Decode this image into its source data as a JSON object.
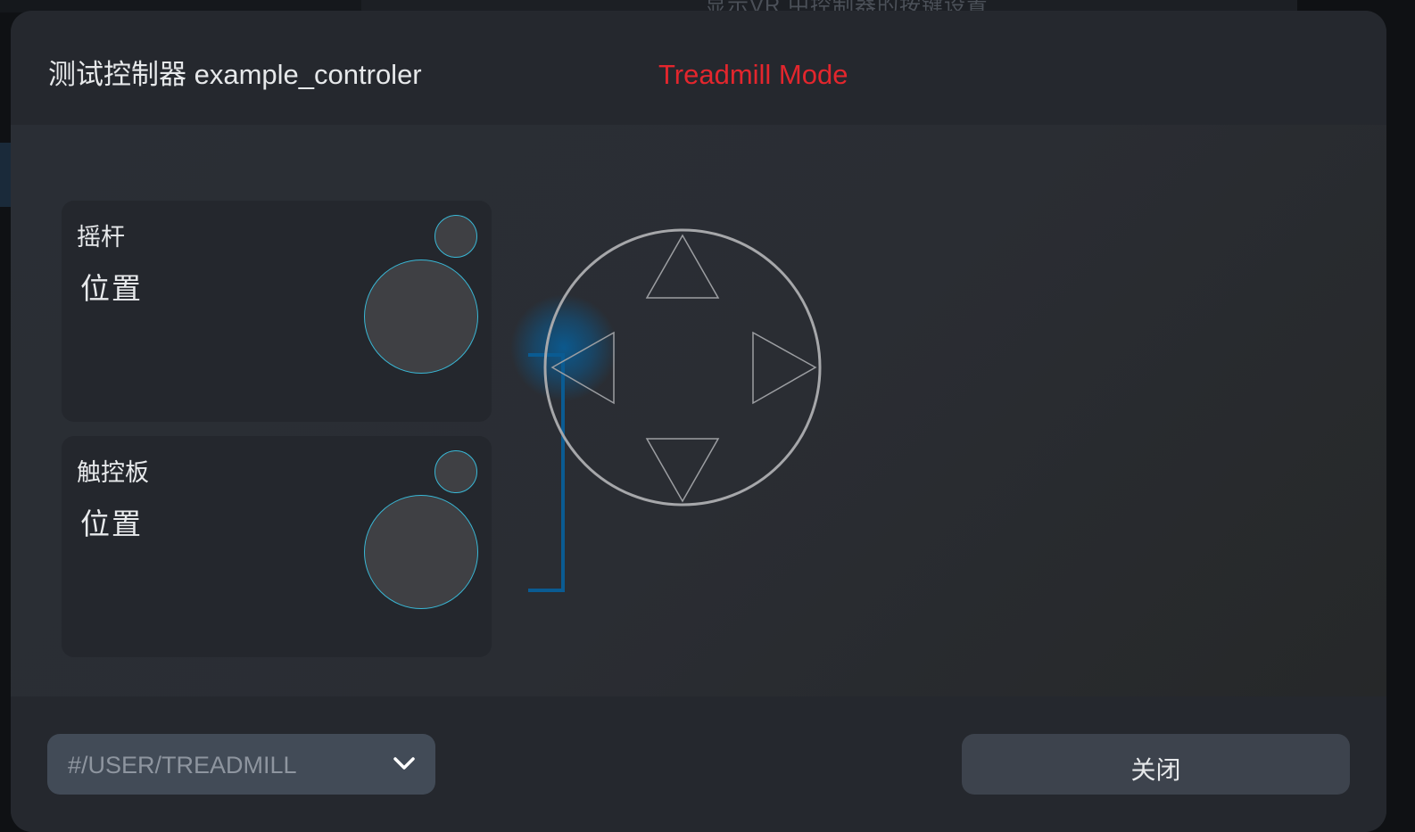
{
  "background": {
    "title_fragment": "显示VR 中控制器的按键设置"
  },
  "dialog": {
    "title": "测试控制器 example_controler",
    "mode_label": "Treadmill Mode",
    "mode_label_color": "#e3262d"
  },
  "panels": [
    {
      "title": "摇杆",
      "subtitle": "位置"
    },
    {
      "title": "触控板",
      "subtitle": "位置"
    }
  ],
  "dpad": {
    "buttons": [
      "up",
      "down",
      "left",
      "right"
    ],
    "highlighted_button": "left",
    "ring_color": "#a6a7aa",
    "highlight_color": "#0a5b92"
  },
  "footer": {
    "path_select": {
      "value": "#/USER/TREADMILL"
    },
    "close_label": "关闭"
  },
  "icons": {
    "dropdown": "chevron-down-icon"
  },
  "colors": {
    "accent_cyan": "#39b8d6",
    "button_bg": "#3d434d",
    "select_bg": "#424b57"
  }
}
